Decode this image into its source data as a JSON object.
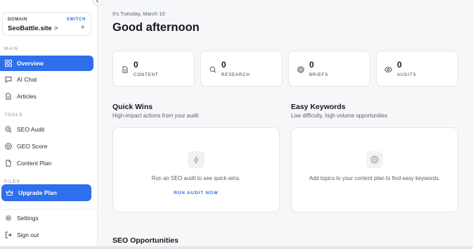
{
  "sidebar": {
    "domain": {
      "label": "DOMAIN",
      "switch_label": "SWITCH",
      "name": "SeoBattle.site",
      "chevron": ">",
      "add": "+"
    },
    "sections": {
      "main": "MAIN",
      "tools": "TOOLS",
      "files": "FILES"
    },
    "items": [
      {
        "label": "Overview",
        "icon": "grid-icon",
        "active": true
      },
      {
        "label": "AI Chat",
        "icon": "chat-icon"
      },
      {
        "label": "Articles",
        "icon": "document-icon"
      },
      {
        "label": "SEO Audit",
        "icon": "search-chart-icon"
      },
      {
        "label": "GEO Score",
        "icon": "globe-icon"
      },
      {
        "label": "Content Plan",
        "icon": "file-icon"
      }
    ],
    "upgrade": {
      "label": "Upgrade Plan",
      "icon": "crown-icon"
    },
    "footer": [
      {
        "label": "Settings",
        "icon": "gear-icon"
      },
      {
        "label": "Sign out",
        "icon": "logout-icon"
      }
    ]
  },
  "main": {
    "date": "It's Tuesday, March 10",
    "greeting": "Good afternoon",
    "stats": [
      {
        "value": "0",
        "label": "CONTENT",
        "icon": "document-icon"
      },
      {
        "value": "0",
        "label": "RESEARCH",
        "icon": "search-icon"
      },
      {
        "value": "0",
        "label": "BRIEFS",
        "icon": "target-icon"
      },
      {
        "value": "0",
        "label": "AUDITS",
        "icon": "eye-icon"
      }
    ],
    "quick_wins": {
      "title": "Quick Wins",
      "subtitle": "High-impact actions from your audit",
      "message": "Run an SEO audit to see quick wins.",
      "cta": "RUN AUDIT NOW",
      "icon": "lightning-icon"
    },
    "easy_keywords": {
      "title": "Easy Keywords",
      "subtitle": "Low difficulty, high volume opportunities",
      "message": "Add topics to your content plan to find easy keywords.",
      "icon": "target-icon"
    },
    "seo_opportunities": {
      "title": "SEO Opportunities"
    }
  },
  "colors": {
    "accent": "#2f6fed",
    "background": "#f6f7f9",
    "card": "#ffffff",
    "muted_text": "#5d626b"
  }
}
